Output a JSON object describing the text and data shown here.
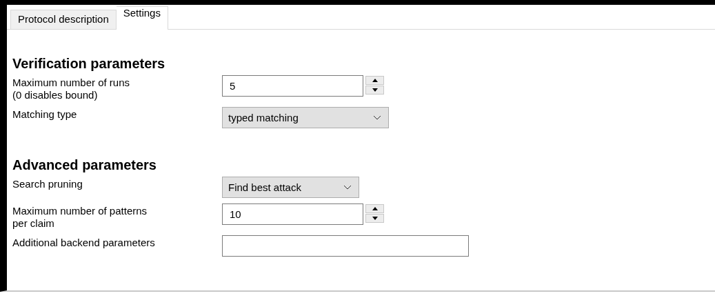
{
  "tabs": [
    {
      "label": "Protocol description",
      "selected": false
    },
    {
      "label": "Settings",
      "selected": true
    }
  ],
  "sections": [
    {
      "title": "Verification parameters",
      "fields": [
        {
          "kind": "spin",
          "label": "Maximum number of runs\n(0 disables bound)",
          "value": "5"
        },
        {
          "kind": "select",
          "label": "Matching type",
          "value": "typed matching"
        }
      ]
    },
    {
      "title": "Advanced parameters",
      "fields": [
        {
          "kind": "select",
          "label": "Search pruning",
          "value": "Find best attack"
        },
        {
          "kind": "spin",
          "label": "Maximum number of patterns\nper claim",
          "value": "10"
        },
        {
          "kind": "text",
          "label": "Additional backend parameters"
        }
      ]
    }
  ]
}
